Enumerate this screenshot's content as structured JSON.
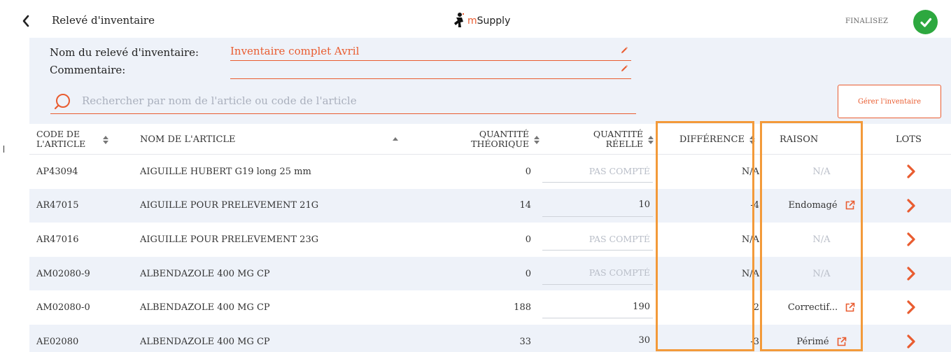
{
  "header": {
    "title": "Relevé d'inventaire",
    "brand_prefix": "m",
    "brand_name": "Supply",
    "finalize_label": "FINALISEZ"
  },
  "form": {
    "name_label": "Nom du relevé d'inventaire:",
    "name_value": "Inventaire complet Avril",
    "comment_label": "Commentaire:",
    "comment_value": "",
    "search_placeholder": "Rechercher par nom de l'article ou code de l'article",
    "manage_button": "Gérer l'inventaire"
  },
  "columns": {
    "code_line1": "CODE DE",
    "code_line2": "L'ARTICLE",
    "name": "NOM DE L'ARTICLE",
    "theoretical_line1": "QUANTITÉ",
    "theoretical_line2": "THÉORIQUE",
    "actual_line1": "QUANTITÉ",
    "actual_line2": "RÉELLE",
    "difference": "DIFFÉRENCE",
    "reason": "RAISON",
    "lots": "LOTS"
  },
  "rows": [
    {
      "code": "AP43094",
      "name": "AIGUILLE HUBERT G19 long 25 mm",
      "theoretical": "0",
      "actual": "PAS COMPTÉ",
      "difference": "N/A",
      "reason": "N/A",
      "counted": false
    },
    {
      "code": "AR47015",
      "name": "AIGUILLE POUR PRELEVEMENT  21G",
      "theoretical": "14",
      "actual": "10",
      "difference": "-4",
      "reason": "Endomagé",
      "counted": true
    },
    {
      "code": "AR47016",
      "name": "AIGUILLE POUR PRELEVEMENT 23G",
      "theoretical": "0",
      "actual": "PAS COMPTÉ",
      "difference": "N/A",
      "reason": "N/A",
      "counted": false
    },
    {
      "code": "AM02080-9",
      "name": "ALBENDAZOLE 400 MG CP",
      "theoretical": "0",
      "actual": "PAS COMPTÉ",
      "difference": "N/A",
      "reason": "N/A",
      "counted": false
    },
    {
      "code": "AM02080-0",
      "name": "ALBENDAZOLE 400 MG CP",
      "theoretical": "188",
      "actual": "190",
      "difference": "2",
      "reason": "Correctif...",
      "counted": true
    },
    {
      "code": "AE02080",
      "name": "ALBENDAZOLE 400 MG CP",
      "theoretical": "33",
      "actual": "30",
      "difference": "-3",
      "reason": "Périmé",
      "counted": true
    }
  ],
  "colors": {
    "accent": "#e95c30",
    "success": "#2da83f",
    "panel": "#eef2f9",
    "highlight": "#f39a3a"
  }
}
